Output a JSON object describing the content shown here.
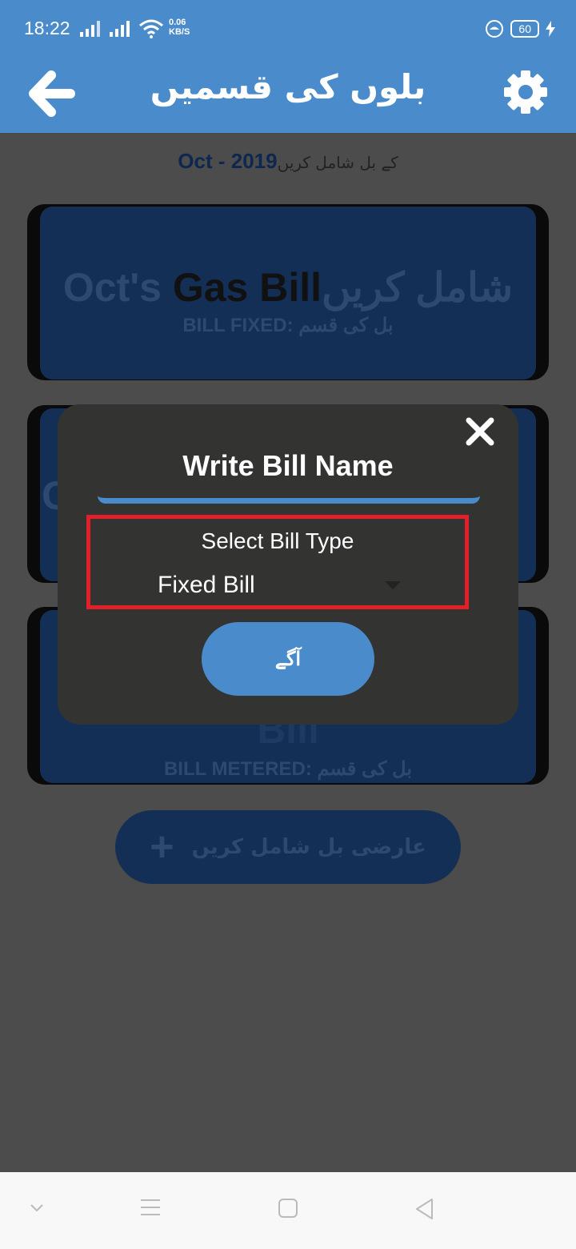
{
  "status_bar": {
    "time": "18:22",
    "net_speed_value": "0.06",
    "net_speed_unit": "KB/S",
    "battery": "60"
  },
  "app_bar": {
    "title": "بلوں کی قسمیں",
    "back_icon": "arrow-left-icon",
    "settings_icon": "gear-icon"
  },
  "main": {
    "subtitle_prefix": "کے بل شامل کریں",
    "subtitle_date": "Oct - 2019",
    "cards": [
      {
        "name_prefix": "Oct's ",
        "name_main": "Gas Bill",
        "name_suffix": "شامل کریں",
        "type": "BILL FIXED: بل کی قسم"
      },
      {
        "name_line1": "C",
        "name_line2": "Bill",
        "type": "BILL METERED: بل کی قسم"
      }
    ],
    "add_temp_label": "عارضی بل شامل کریں",
    "add_temp_icon": "plus-icon"
  },
  "dialog": {
    "title": "Write Bill Name",
    "name_value": "",
    "select_label": "Select Bill Type",
    "selected_type": "Fixed Bill",
    "next_label": "آگے",
    "close_icon": "close-icon"
  },
  "nav_bar": {
    "icons": [
      "chevron-down-icon",
      "menu-icon",
      "home-square-icon",
      "back-triangle-icon"
    ]
  },
  "colors": {
    "primary": "#4a8bcb",
    "dialog_bg": "#333332",
    "highlight": "#e3202a",
    "overlay_bg": "#4c4c4c"
  }
}
